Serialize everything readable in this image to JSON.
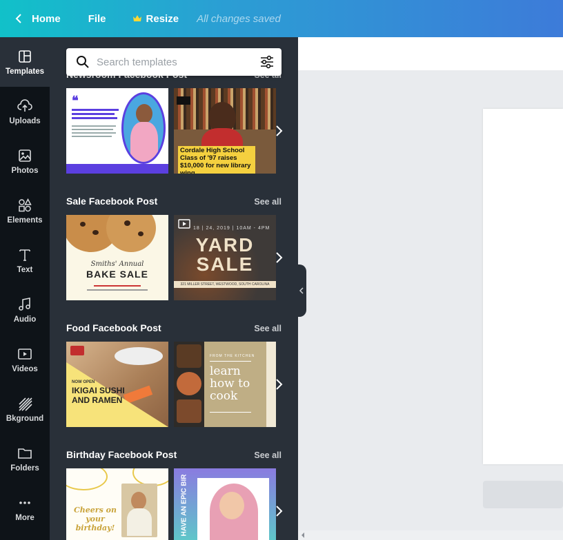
{
  "topbar": {
    "home_label": "Home",
    "file_label": "File",
    "resize_label": "Resize",
    "status_text": "All changes saved"
  },
  "rail": {
    "items": [
      {
        "label": "Templates",
        "icon": "templates-icon"
      },
      {
        "label": "Uploads",
        "icon": "upload-cloud-icon"
      },
      {
        "label": "Photos",
        "icon": "image-icon"
      },
      {
        "label": "Elements",
        "icon": "shapes-icon"
      },
      {
        "label": "Text",
        "icon": "text-icon"
      },
      {
        "label": "Audio",
        "icon": "music-note-icon"
      },
      {
        "label": "Videos",
        "icon": "video-play-icon"
      },
      {
        "label": "Bkground",
        "icon": "background-pattern-icon"
      },
      {
        "label": "Folders",
        "icon": "folder-icon"
      },
      {
        "label": "More",
        "icon": "more-dots-icon"
      }
    ]
  },
  "search": {
    "placeholder": "Search templates"
  },
  "sections": [
    {
      "title": "Newsroom Facebook Post",
      "see_all": "See all",
      "thumbs": [
        {
          "text": "Cordale High School Class of '97 raises $10,000 for new library wing"
        }
      ]
    },
    {
      "title": "Sale Facebook Post",
      "see_all": "See all",
      "thumbs": [
        {
          "script": "Smiths' Annual",
          "headline": "BAKE SALE"
        },
        {
          "date": "18 | 24, 2019 | 10AM - 4PM",
          "headline_1": "YARD",
          "headline_2": "SALE",
          "address": "321 MILLER STREET, WESTWOOD, SOUTH CAROLINA"
        }
      ]
    },
    {
      "title": "Food Facebook Post",
      "see_all": "See all",
      "thumbs": [
        {
          "kicker": "NOW OPEN",
          "headline": "IKIGAI SUSHI AND RAMEN"
        },
        {
          "kicker": "FROM THE KITCHEN",
          "headline": "learn how to cook"
        }
      ]
    },
    {
      "title": "Birthday Facebook Post",
      "see_all": "See all",
      "thumbs": [
        {
          "headline": "Cheers on your birthday!"
        },
        {
          "headline": "HAVE AN EPIC BIRTHDAY!"
        }
      ]
    }
  ],
  "colors": {
    "topbar_start": "#11c1c9",
    "topbar_end": "#3d7bd9",
    "rail_bg": "#0e1318",
    "panel_bg": "#293039"
  }
}
